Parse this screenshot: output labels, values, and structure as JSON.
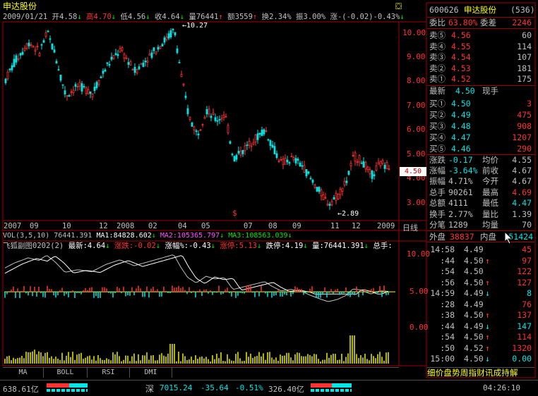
{
  "title": "申达股份",
  "info_bar": {
    "date": "2009/01/21",
    "open_label": "开",
    "open": "4.58",
    "high_label": "高",
    "high": "4.70",
    "low_label": "低",
    "low": "4.56",
    "close_label": "收",
    "close": "4.64",
    "vol_label": "量",
    "vol": "76441",
    "amt_label": "额",
    "amt": "3559",
    "turn_label": "换",
    "turn": "2.34%",
    "amp_label": "振",
    "amp": "3.00%",
    "chg_label": "涨",
    "chg": "-(-0.02)-0.43%"
  },
  "price_axis": [
    "10.00",
    "9.00",
    "8.00",
    "7.00",
    "6.00",
    "5.00",
    "4.00",
    "3.00"
  ],
  "price_annotations": {
    "high": "10.27",
    "low": "2.89",
    "current": "4.50"
  },
  "time_axis": [
    "2007",
    "09",
    "10",
    "12",
    "2008",
    "02",
    "04",
    "05",
    "07",
    "08",
    "09",
    "11",
    "12",
    "2009"
  ],
  "time_axis_unit": "日线",
  "vol_line": {
    "name": "VOL(3,5,10)",
    "val": "76441.391",
    "ma1_label": "MA1:",
    "ma1": "84828.602",
    "ma2_label": "MA2:",
    "ma2": "105365.797",
    "ma3_label": "MA3:",
    "ma3": "108563.039"
  },
  "sub_line": {
    "name": "飞狐副图0202(2)",
    "latest_label": "最新:",
    "latest": "4.64",
    "rise_label": "涨跌:",
    "rise": "-0.02",
    "pct_label": "涨幅%:",
    "pct": "-0.43",
    "limitup_label": "涨停:",
    "limitup": "5.13",
    "limitdown_label": "跌停:",
    "limitdown": "4.19",
    "vol_label": "量:",
    "vol": "76441.391",
    "hands_label": "总手:"
  },
  "sub_axis": [
    "10.00",
    "5.00",
    "0.00"
  ],
  "bottom_tabs": [
    "MA",
    "BOLL",
    "RSI",
    "DMI"
  ],
  "status_bar": {
    "sh_value": "638.61亿",
    "sz_label": "深",
    "sz_index": "7015.24",
    "sz_chg": "-35.64",
    "sz_pct": "-0.51%",
    "sz_amt": "326.40亿",
    "time": "04:26:10"
  },
  "quote": {
    "code": "600626",
    "name": "申达股份",
    "num": "(536)",
    "wei_label": "委比",
    "wei_bi": "63.80%",
    "wei_cha_label": "委差",
    "wei_cha": "2246",
    "sells": [
      {
        "label": "卖⑤",
        "price": "4.56",
        "vol": "60"
      },
      {
        "label": "卖④",
        "price": "4.55",
        "vol": "114"
      },
      {
        "label": "卖③",
        "price": "4.54",
        "vol": "107"
      },
      {
        "label": "卖②",
        "price": "4.53",
        "vol": "181"
      },
      {
        "label": "卖①",
        "price": "4.52",
        "vol": "175"
      }
    ],
    "latest_label": "最新",
    "latest": "4.50",
    "hand_label": "现手",
    "buys": [
      {
        "label": "买①",
        "price": "4.50",
        "vol": "3"
      },
      {
        "label": "买②",
        "price": "4.49",
        "vol": "475"
      },
      {
        "label": "买③",
        "price": "4.48",
        "vol": "908"
      },
      {
        "label": "买④",
        "price": "4.47",
        "vol": "1207"
      },
      {
        "label": "买⑤",
        "price": "4.46",
        "vol": "290"
      }
    ],
    "stats": [
      {
        "l1": "涨跌",
        "v1": "-0.17",
        "l2": "均价",
        "v2": "4.55"
      },
      {
        "l1": "涨幅",
        "v1": "-3.64%",
        "l2": "前收",
        "v2": "4.67"
      },
      {
        "l1": "振幅",
        "v1": "4.71%",
        "l2": "今开",
        "v2": "4.67"
      },
      {
        "l1": "总手",
        "v1": "90261",
        "l2": "最高",
        "v2": "4.69"
      },
      {
        "l1": "总额",
        "v1": "4111",
        "l2": "最低",
        "v2": "4.47"
      },
      {
        "l1": "换手",
        "v1": "2.77%",
        "l2": "量比",
        "v2": "1.39"
      },
      {
        "l1": "分笔",
        "v1": "1289",
        "l2": "均量",
        "v2": "70"
      }
    ],
    "outer_label": "外盘",
    "outer": "38837",
    "inner_label": "内盘",
    "inner": "51424",
    "ticks": [
      {
        "t": "14:58",
        "p": "4.49",
        "a": "",
        "v": "45"
      },
      {
        "t": ":44",
        "p": "4.50",
        "a": "↑",
        "v": "97"
      },
      {
        "t": ":54",
        "p": "4.50",
        "a": "",
        "v": "122"
      },
      {
        "t": ":56",
        "p": "4.50",
        "a": "↑",
        "v": "127"
      },
      {
        "t": "14:59",
        "p": "4.49",
        "a": "↓",
        "v": "8"
      },
      {
        "t": ":28",
        "p": "4.49",
        "a": "",
        "v": "76"
      },
      {
        "t": ":38",
        "p": "4.50",
        "a": "↑",
        "v": "137"
      },
      {
        "t": ":44",
        "p": "4.49",
        "a": "↓",
        "v": "147"
      },
      {
        "t": ":54",
        "p": "4.50",
        "a": "↑",
        "v": "114"
      },
      {
        "t": ":50",
        "p": "4.52",
        "a": "↑",
        "v": "1320"
      },
      {
        "t": "15:00",
        "p": "4.50",
        "a": "↓",
        "v": "0.00"
      }
    ],
    "bottom_tabs": "细价盘势周指财讯成持解"
  }
}
